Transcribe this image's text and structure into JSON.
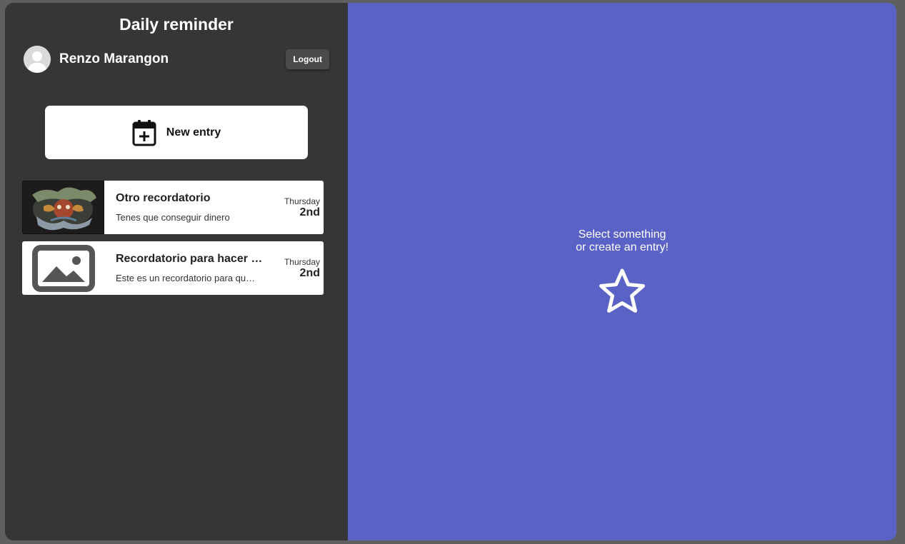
{
  "app": {
    "title": "Daily reminder"
  },
  "user": {
    "name": "Renzo Marangon",
    "avatar_icon": "user-avatar-icon",
    "logout_label": "Logout"
  },
  "new_entry": {
    "label": "New entry",
    "icon": "calendar-plus-icon"
  },
  "entries": [
    {
      "title": "Otro recordatorio",
      "text": "Tenes que conseguir dinero",
      "weekday": "Thursday",
      "day": "2nd",
      "thumbnail": "photo"
    },
    {
      "title": "Recordatorio para hacer …",
      "text": "Este es un recordatorio para qu…",
      "weekday": "Thursday",
      "day": "2nd",
      "thumbnail": "image-placeholder-icon"
    }
  ],
  "main": {
    "empty_line_1": "Select something",
    "empty_line_2": "or create an entry!",
    "icon": "star-icon"
  },
  "colors": {
    "sidebar_bg": "#363636",
    "main_bg": "#5b62c6",
    "frame_bg": "#5f5f5f",
    "card_bg": "#ffffff"
  }
}
